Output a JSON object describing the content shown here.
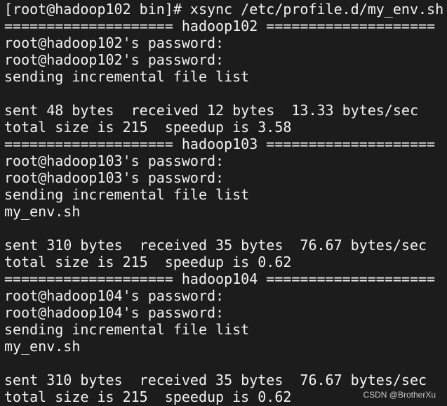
{
  "terminal": {
    "lines": [
      "[root@hadoop102 bin]# xsync /etc/profile.d/my_env.sh",
      "==================== hadoop102 ====================",
      "root@hadoop102's password:",
      "root@hadoop102's password:",
      "sending incremental file list",
      "",
      "sent 48 bytes  received 12 bytes  13.33 bytes/sec",
      "total size is 215  speedup is 3.58",
      "==================== hadoop103 ====================",
      "root@hadoop103's password:",
      "root@hadoop103's password:",
      "sending incremental file list",
      "my_env.sh",
      "",
      "sent 310 bytes  received 35 bytes  76.67 bytes/sec",
      "total size is 215  speedup is 0.62",
      "==================== hadoop104 ====================",
      "root@hadoop104's password:",
      "root@hadoop104's password:",
      "sending incremental file list",
      "my_env.sh",
      "",
      "sent 310 bytes  received 35 bytes  76.67 bytes/sec",
      "total size is 215  speedup is 0.62"
    ]
  },
  "watermark": "CSDN @BrotherXu",
  "colors": {
    "background": "#1c1c1c",
    "text": "#f2f2f2"
  }
}
